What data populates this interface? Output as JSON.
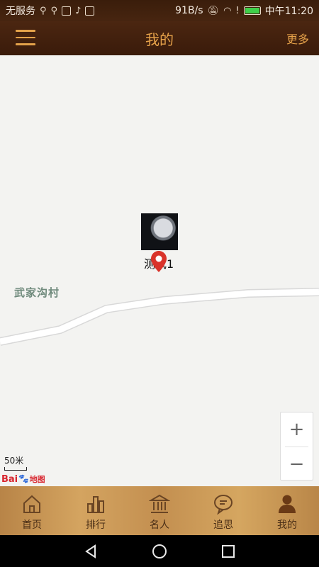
{
  "status_bar": {
    "carrier": "无服务",
    "speed": "91B/s",
    "time": "中午11:20"
  },
  "header": {
    "title": "我的",
    "more_label": "更多",
    "menu_icon": "hamburger-menu-icon"
  },
  "map": {
    "place_label": "武家沟村",
    "marker_label": "测试1",
    "scale_label": "50米",
    "logo_text": "Bai",
    "logo_sub": "地图",
    "zoom_in_label": "+",
    "zoom_out_label": "−"
  },
  "tabs": [
    {
      "label": "首页",
      "icon": "home-icon"
    },
    {
      "label": "排行",
      "icon": "ranking-icon"
    },
    {
      "label": "名人",
      "icon": "temple-icon"
    },
    {
      "label": "追思",
      "icon": "chat-bubble-icon"
    },
    {
      "label": "我的",
      "icon": "person-icon"
    }
  ],
  "colors": {
    "accent": "#e6a24a",
    "header_bg": "#452210",
    "pin": "#d9332a",
    "tab_text": "#4a2e16"
  }
}
